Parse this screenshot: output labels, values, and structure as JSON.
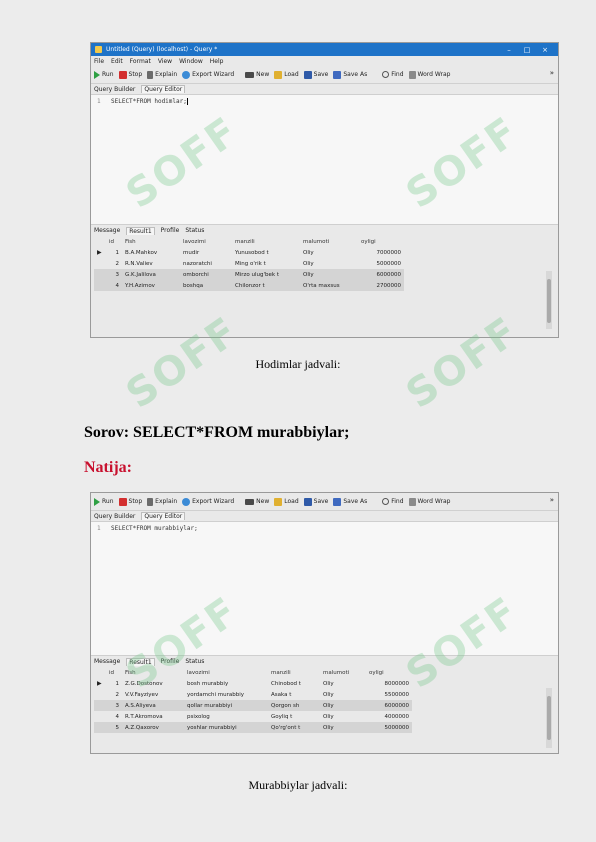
{
  "window": {
    "title": "Untitled (Query) (localhost) - Query *",
    "menu": [
      "File",
      "Edit",
      "Format",
      "View",
      "Window",
      "Help"
    ]
  },
  "toolbar": {
    "run": "Run",
    "stop": "Stop",
    "explain": "Explain",
    "export": "Export Wizard",
    "new": "New",
    "load": "Load",
    "save": "Save",
    "save_as": "Save As",
    "find": "Find",
    "word_wrap": "Word Wrap"
  },
  "subtabs": {
    "builder": "Query Builder",
    "editor": "Query Editor"
  },
  "result_tabs": {
    "message": "Message",
    "result": "Result1",
    "profile": "Profile",
    "status": "Status"
  },
  "query1": {
    "line_no": "1",
    "sql": "SELECT*FROM hodimlar;",
    "columns": [
      "id",
      "Fish",
      "lavozimi",
      "manzili",
      "malumoti",
      "oyligi"
    ],
    "rows": [
      [
        "1",
        "B.A.Mahkov",
        "mudir",
        "Yunusobod t",
        "Oliy",
        "7000000"
      ],
      [
        "2",
        "R.N.Valiev",
        "nazoratchi",
        "Ming o'rik t",
        "Oliy",
        "5000000"
      ],
      [
        "3",
        "G.K.Jalilova",
        "omborchi",
        "Mirzo ulug'bek t",
        "Oliy",
        "6000000"
      ],
      [
        "4",
        "Y.H.Azimov",
        "boshqa",
        "Chilonzor t",
        "O'rta maxsus",
        "2700000"
      ]
    ],
    "caption": "Hodimlar jadvali:"
  },
  "section": {
    "sorov": "Sorov: SELECT*FROM murabbiylar;",
    "natija": "Natija:"
  },
  "query2": {
    "line_no": "1",
    "sql": "SELECT*FROM murabbiylar;",
    "columns": [
      "id",
      "Fish",
      "lavozimi",
      "manzili",
      "malumoti",
      "oyligi"
    ],
    "rows": [
      [
        "1",
        "Z.G.Dostonov",
        "bosh murabbiy",
        "Chinobod t",
        "Oliy",
        "8000000"
      ],
      [
        "2",
        "V.V.Fayziyev",
        "yordamchi murabbiy",
        "Asaka t",
        "Oliy",
        "5500000"
      ],
      [
        "3",
        "A.S.Aliyeva",
        "qollar murabbiyi",
        "Qorgon sh",
        "Oliy",
        "6000000"
      ],
      [
        "4",
        "R.T.Akromova",
        "psixolog",
        "Goyliq t",
        "Oliy",
        "4000000"
      ],
      [
        "5",
        "A.Z.Qaxorov",
        "yoshlar murabbiyi",
        "Qo'rg'ont t",
        "Oliy",
        "5000000"
      ]
    ],
    "caption": "Murabbiylar jadvali:"
  },
  "watermark": "SOFF"
}
